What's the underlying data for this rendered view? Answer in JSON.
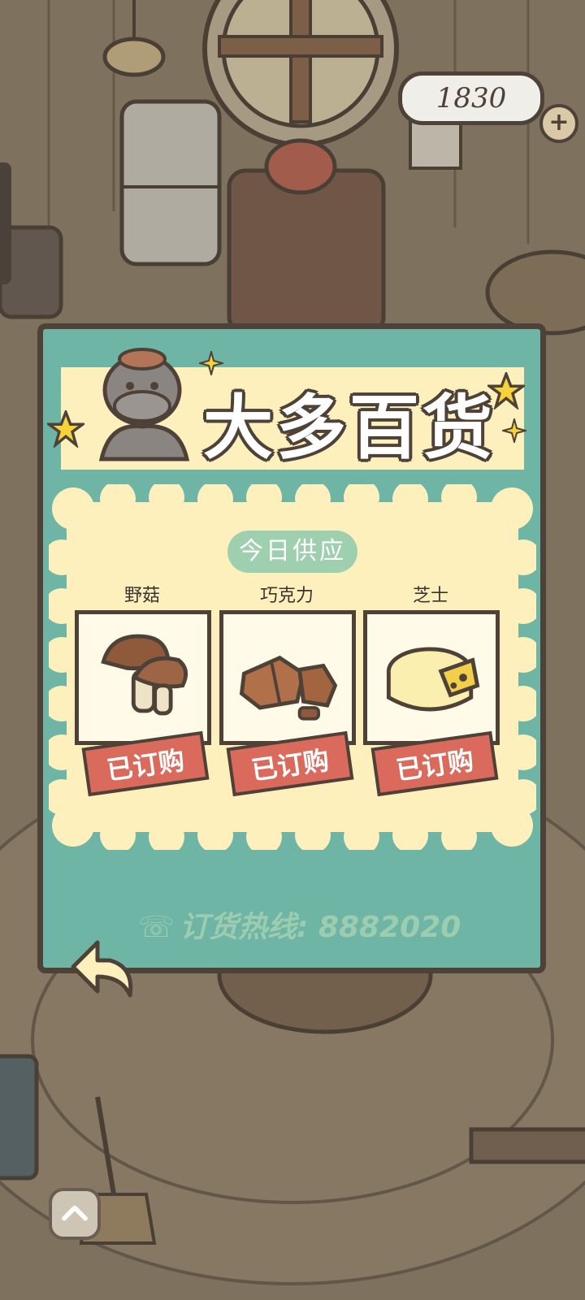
{
  "hud": {
    "coins": "1830",
    "plus_symbol": "+"
  },
  "shop": {
    "title": "大多百货",
    "section_title": "今日供应",
    "items": [
      {
        "name": "野菇",
        "status": "已订购",
        "icon": "mushroom-icon"
      },
      {
        "name": "巧克力",
        "status": "已订购",
        "icon": "chocolate-icon"
      },
      {
        "name": "芝士",
        "status": "已订购",
        "icon": "cheese-icon"
      }
    ],
    "hotline": "订货热线: 8882020"
  },
  "colors": {
    "panel": "#6fb5a5",
    "banner": "#fdf0bd",
    "supply_bg": "#fdf0bd",
    "badge": "#d96a5c",
    "outline": "#4e4238"
  }
}
